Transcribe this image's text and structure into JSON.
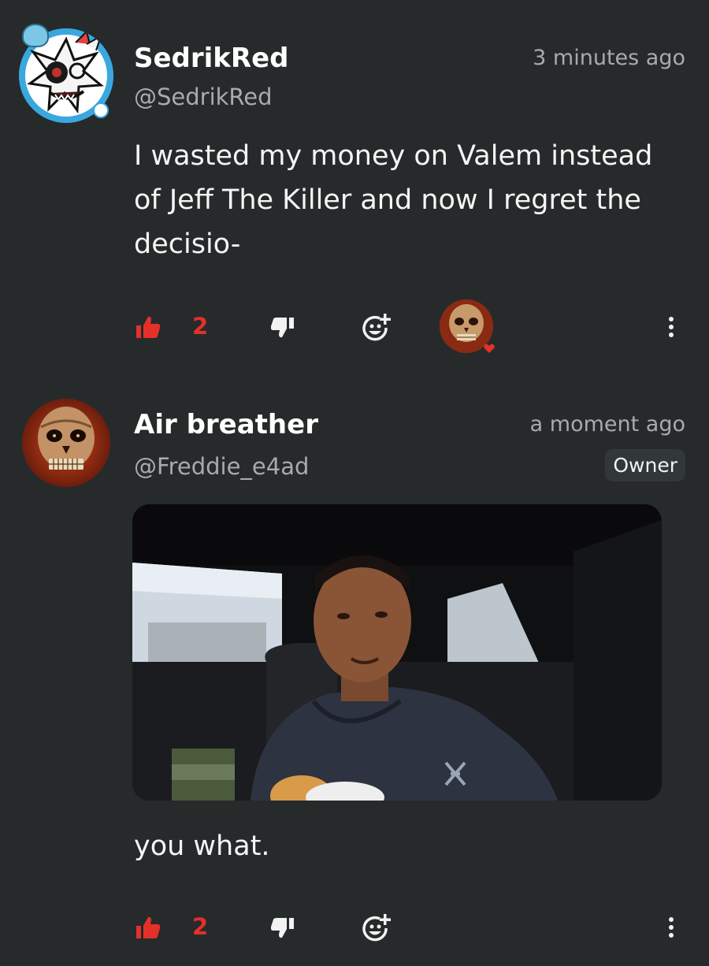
{
  "comments": [
    {
      "username": "SedrikRed",
      "handle": "@SedrikRed",
      "time": "3 minutes ago",
      "text": "I wasted my money on Valem instead of Jeff The Killer and now I regret the decisio-",
      "likes": "2"
    },
    {
      "username": "Air breather",
      "handle": "@Freddie_e4ad",
      "time": "a moment ago",
      "badge": "Owner",
      "text": "you what.",
      "likes": "2"
    }
  ],
  "colors": {
    "background": "#262a2b",
    "like_red": "#e5302a",
    "badge_bg": "#32383a"
  },
  "icons": {
    "like": "thumbs-up-icon",
    "dislike": "thumbs-down-icon",
    "react": "emoji-add-icon",
    "more": "more-vertical-icon",
    "heart": "heart-icon"
  }
}
